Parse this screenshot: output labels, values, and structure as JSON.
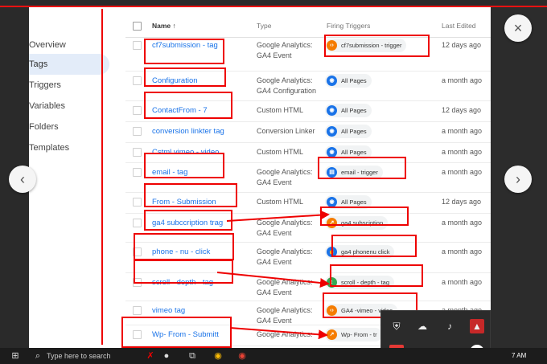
{
  "sidebar": {
    "items": [
      {
        "label": "Overview"
      },
      {
        "label": "Tags"
      },
      {
        "label": "Triggers"
      },
      {
        "label": "Variables"
      },
      {
        "label": "Folders"
      },
      {
        "label": "Templates"
      }
    ]
  },
  "table": {
    "headers": {
      "name": "Name ↑",
      "type": "Type",
      "triggers": "Firing Triggers",
      "edited": "Last Edited"
    },
    "rows": [
      {
        "name": "cf7submission - tag",
        "type1": "Google Analytics:",
        "type2": "GA4 Event",
        "trigger": "cf7submission - trigger",
        "trigger_icon": "code-icon",
        "trigger_color": "#f57c00",
        "edited": "12 days ago"
      },
      {
        "name": "Configuration",
        "type1": "Google Analytics:",
        "type2": "GA4 Configuration",
        "trigger": "All Pages",
        "trigger_icon": "eye-icon",
        "trigger_color": "#1a73e8",
        "edited": "a month ago"
      },
      {
        "name": "ContactFrom - 7",
        "type1": "Custom HTML",
        "type2": "",
        "trigger": "All Pages",
        "trigger_icon": "eye-icon",
        "trigger_color": "#1a73e8",
        "edited": "12 days ago"
      },
      {
        "name": "conversion linkter tag",
        "type1": "Conversion Linker",
        "type2": "",
        "trigger": "All Pages",
        "trigger_icon": "eye-icon",
        "trigger_color": "#1a73e8",
        "edited": "a month ago"
      },
      {
        "name": "Cstml vimeo - video",
        "type1": "Custom HTML",
        "type2": "",
        "trigger": "All Pages",
        "trigger_icon": "eye-icon",
        "trigger_color": "#1a73e8",
        "edited": "a month ago"
      },
      {
        "name": "email - tag",
        "type1": "Google Analytics:",
        "type2": "GA4 Event",
        "trigger": "email - trigger",
        "trigger_icon": "form-icon",
        "trigger_color": "#1a73e8",
        "edited": "a month ago"
      },
      {
        "name": "From - Submission",
        "type1": "Custom HTML",
        "type2": "",
        "trigger": "All Pages",
        "trigger_icon": "eye-icon",
        "trigger_color": "#1a73e8",
        "edited": "12 days ago"
      },
      {
        "name": "ga4 subccription trag",
        "type1": "Google Analytics:",
        "type2": "GA4 Event",
        "trigger": "ga4 subsciption",
        "trigger_icon": "custom-event-icon",
        "trigger_color": "#f57c00",
        "edited": "a month ago"
      },
      {
        "name": "phone - nu - click",
        "type1": "Google Analytics:",
        "type2": "GA4 Event",
        "trigger": "ga4 phonenu click",
        "trigger_icon": "click-icon",
        "trigger_color": "#1a73e8",
        "edited": "a month ago"
      },
      {
        "name": "scroll - depth - tag",
        "type1": "Google Analytics:",
        "type2": "GA4 Event",
        "trigger": "scroll - depth - tag",
        "trigger_icon": "scroll-icon",
        "trigger_color": "#34a853",
        "edited": "a month ago"
      },
      {
        "name": "vimeo tag",
        "type1": "Google Analytics:",
        "type2": "GA4 Event",
        "trigger": "GA4 -vimeo - video",
        "trigger_icon": "code-icon",
        "trigger_color": "#f57c00",
        "edited": "a month ago"
      },
      {
        "name": "Wp- From - Submitt",
        "type1": "Google Analytics:",
        "type2": "",
        "trigger": "Wp- From - tr",
        "trigger_icon": "custom-event-icon",
        "trigger_color": "#f57c00",
        "edited": ""
      }
    ]
  },
  "taskbar": {
    "search_placeholder": "Type here to search",
    "clock": "7 AM"
  },
  "colors": {
    "annotation": "#e00000",
    "link": "#1a73e8",
    "active_nav": "#e3ecf9"
  }
}
